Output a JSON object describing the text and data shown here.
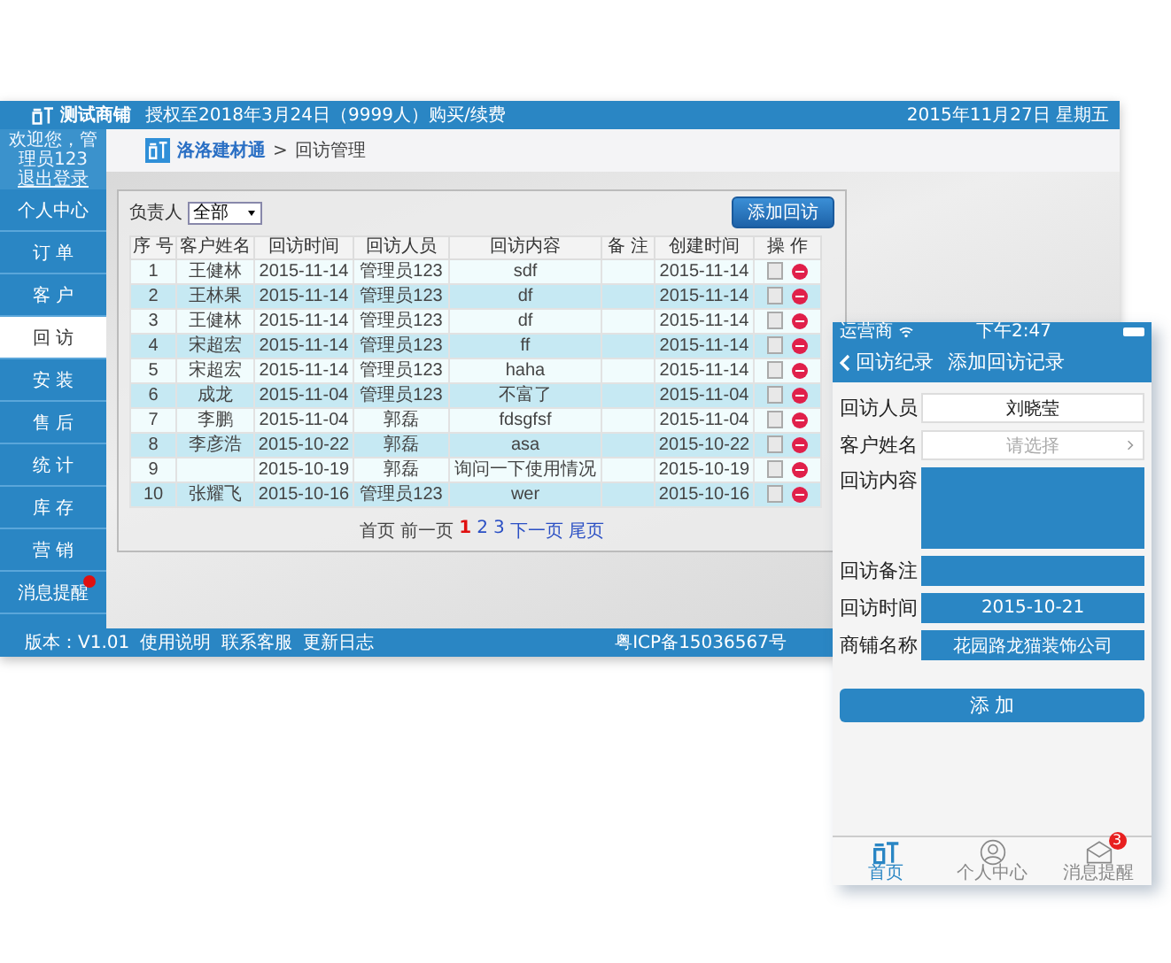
{
  "desktop": {
    "app_name": "测试商铺",
    "license_text": "授权至2018年3月24日（9999人）购买/续费",
    "date_text": "2015年11月27日 星期五",
    "user_greeting": "欢迎您，管理员123",
    "logout_link": "退出登录",
    "menu": [
      {
        "label": "个人中心",
        "selected": false,
        "notification": false
      },
      {
        "label": "订 单",
        "selected": false,
        "notification": false
      },
      {
        "label": "客 户",
        "selected": false,
        "notification": false
      },
      {
        "label": "回 访",
        "selected": true,
        "notification": false
      },
      {
        "label": "安 装",
        "selected": false,
        "notification": false
      },
      {
        "label": "售 后",
        "selected": false,
        "notification": false
      },
      {
        "label": "统 计",
        "selected": false,
        "notification": false
      },
      {
        "label": "库 存",
        "selected": false,
        "notification": false
      },
      {
        "label": "营 销",
        "selected": false,
        "notification": false
      },
      {
        "label": "消息提醒",
        "selected": false,
        "notification": true
      }
    ],
    "breadcrumb": {
      "home": "洛洛建材通",
      "separator": ">",
      "current": "回访管理"
    },
    "filter": {
      "label": "负责人",
      "value": "全部"
    },
    "add_button": "添加回访",
    "table": {
      "columns": [
        "序 号",
        "客户姓名",
        "回访时间",
        "回访人员",
        "回访内容",
        "备 注",
        "创建时间",
        "操 作"
      ],
      "rows": [
        {
          "cells": [
            "1",
            "王健林",
            "2015-11-14",
            "管理员123",
            "sdf",
            "",
            "2015-11-14"
          ]
        },
        {
          "cells": [
            "2",
            "王林果",
            "2015-11-14",
            "管理员123",
            "df",
            "",
            "2015-11-14"
          ]
        },
        {
          "cells": [
            "3",
            "王健林",
            "2015-11-14",
            "管理员123",
            "df",
            "",
            "2015-11-14"
          ]
        },
        {
          "cells": [
            "4",
            "宋超宏",
            "2015-11-14",
            "管理员123",
            "ff",
            "",
            "2015-11-14"
          ]
        },
        {
          "cells": [
            "5",
            "宋超宏",
            "2015-11-14",
            "管理员123",
            "haha",
            "",
            "2015-11-14"
          ]
        },
        {
          "cells": [
            "6",
            "成龙",
            "2015-11-04",
            "管理员123",
            "不富了",
            "",
            "2015-11-04"
          ]
        },
        {
          "cells": [
            "7",
            "李鹏",
            "2015-11-04",
            "郭磊",
            "fdsgfsf",
            "",
            "2015-11-04"
          ]
        },
        {
          "cells": [
            "8",
            "李彦浩",
            "2015-10-22",
            "郭磊",
            "asa",
            "",
            "2015-10-22"
          ]
        },
        {
          "cells": [
            "9",
            "",
            "2015-10-19",
            "郭磊",
            "询问一下使用情况",
            "",
            "2015-10-19"
          ]
        },
        {
          "cells": [
            "10",
            "张耀飞",
            "2015-10-16",
            "管理员123",
            "wer",
            "",
            "2015-10-16"
          ]
        }
      ]
    },
    "pagination": {
      "first": "首页",
      "prev": "前一页",
      "pages": [
        {
          "label": "1",
          "selected": true
        },
        {
          "label": "2",
          "selected": false
        },
        {
          "label": "3",
          "selected": false
        }
      ],
      "next": "下一页",
      "last": "尾页"
    },
    "footer": {
      "version": "版本：V1.01",
      "links": [
        "使用说明",
        "联系客服",
        "更新日志"
      ],
      "icp": "粤ICP备15036567号"
    }
  },
  "mobile": {
    "carrier": "运营商",
    "time": "下午2:47",
    "back_label": "回访纪录",
    "title": "添加回访记录",
    "fields": [
      {
        "kind": "text",
        "label": "回访人员",
        "value": "刘晓莹"
      },
      {
        "kind": "select",
        "label": "客户姓名",
        "placeholder": "请选择"
      },
      {
        "kind": "area",
        "label": "回访内容"
      },
      {
        "kind": "filled",
        "label": "回访备注"
      },
      {
        "kind": "filled",
        "label": "回访时间",
        "value": "2015-10-21"
      },
      {
        "kind": "filled",
        "label": "商铺名称",
        "value": "花园路龙猫装饰公司"
      }
    ],
    "submit": "添 加",
    "tabs": [
      {
        "kind": "home",
        "label": "首页",
        "selected": true
      },
      {
        "kind": "person",
        "label": "个人中心",
        "selected": false
      },
      {
        "kind": "mail",
        "label": "消息提醒",
        "selected": false,
        "badge": "3"
      }
    ]
  }
}
